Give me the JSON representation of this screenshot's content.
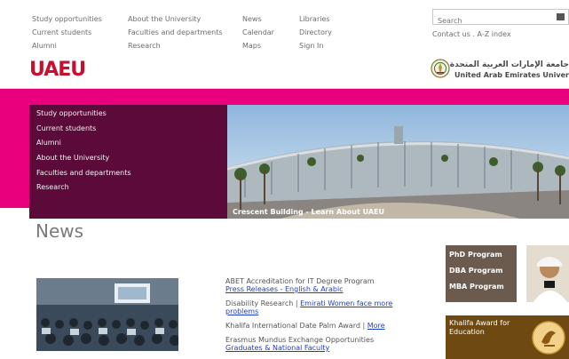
{
  "nav": {
    "col1": [
      "Study opportunities",
      "Current students",
      "Alumni"
    ],
    "col2": [
      "About the University",
      "Faculties and departments",
      "Research"
    ],
    "col3": [
      "News",
      "Calendar",
      "Maps"
    ],
    "col4": [
      "Libraries",
      "Directory",
      "Sign In"
    ]
  },
  "search": {
    "placeholder": "Search"
  },
  "contact": "Contact us . A-Z index",
  "logo": "UAEU",
  "university": {
    "arabic": "جامعة الإمارات العربية المتحدة",
    "english": "United Arab Emirates University"
  },
  "menu": [
    "Study opportunities",
    "Current students",
    "Alumni",
    "About the University",
    "Faculties and departments",
    "Research"
  ],
  "hero": {
    "caption": "Crescent Building - Learn About UAEU"
  },
  "news": {
    "title": "News",
    "items": [
      {
        "title": "ABET Accreditation for IT Degree Program",
        "link": "Press Releases - English & Arabic"
      },
      {
        "title": "Disability Research |",
        "link": "Emirati Women face more problems"
      },
      {
        "title": "Khalifa International Date Palm Award |",
        "link": "More"
      },
      {
        "title": "Erasmus Mundus Exchange Opportunities",
        "link": "Graduates & National Faculty"
      }
    ]
  },
  "programs": [
    "PhD Program",
    "DBA Program",
    "MBA Program"
  ],
  "award": {
    "text": "Khalifa Award for Education"
  },
  "colors": {
    "brand_red": "#c8102e",
    "band_magenta": "#e8007d",
    "menu_plum": "#5b0a3a",
    "program_brown": "#6b5b4f",
    "award_brown": "#6e4a12",
    "link_blue": "#1f3fbf"
  }
}
